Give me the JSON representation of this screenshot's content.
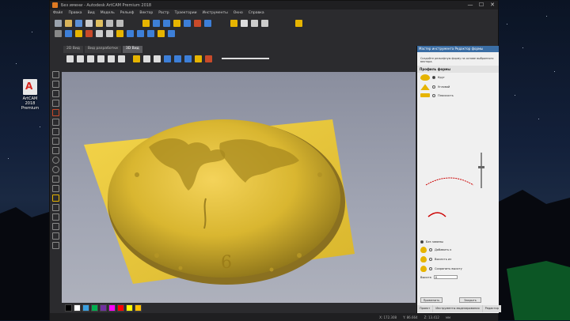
{
  "desktop": {
    "icon_label": "ArtCAM 2018 Premium",
    "icon_glyph": "A"
  },
  "window": {
    "title": "Без имени - Autodesk ArtCAM Premium 2018",
    "buttons": {
      "minimize": "—",
      "maximize": "☐",
      "close": "✕"
    }
  },
  "menu": [
    "Файл",
    "Правка",
    "Вид",
    "Модель",
    "Рельеф",
    "Вектор",
    "Растр",
    "Траектории",
    "Инструменты",
    "Окно",
    "Справка"
  ],
  "doc_tabs": [
    "2D Вид",
    "Вид разработки",
    "3D Вид"
  ],
  "doc_tabs_active": 2,
  "palette_colors": [
    "#000000",
    "#ffffff",
    "#3aa0e0",
    "#00b050",
    "#7030a0",
    "#ff00ff",
    "#ff0000",
    "#ffff00",
    "#ffc000"
  ],
  "panel": {
    "title": "Мастер инструмента Редактор формы",
    "intro": "Создайте рельефную форму на основе выбранного вектора.",
    "section": "Профиль формы",
    "shapes": [
      "Круг",
      "Угловой",
      "Плоскость"
    ],
    "mode_options": [
      "Без замены",
      "Добавить к",
      "Вычесть из",
      "Сохранить высоту"
    ],
    "height_label": "Высота",
    "height_value": "0",
    "buttons": {
      "apply": "Применить",
      "close": "Закрыть"
    },
    "tabs": [
      "Проект",
      "Инструменты моделирования",
      "Редактор"
    ]
  },
  "status": {
    "x": "X: 172.308",
    "y": "Y: 86.664",
    "z": "Z: 13.412",
    "units": "мм"
  },
  "scene": {
    "plate_color": "#e8c43a",
    "relief_color": "#c9a92a",
    "dial_numeral": "6"
  }
}
